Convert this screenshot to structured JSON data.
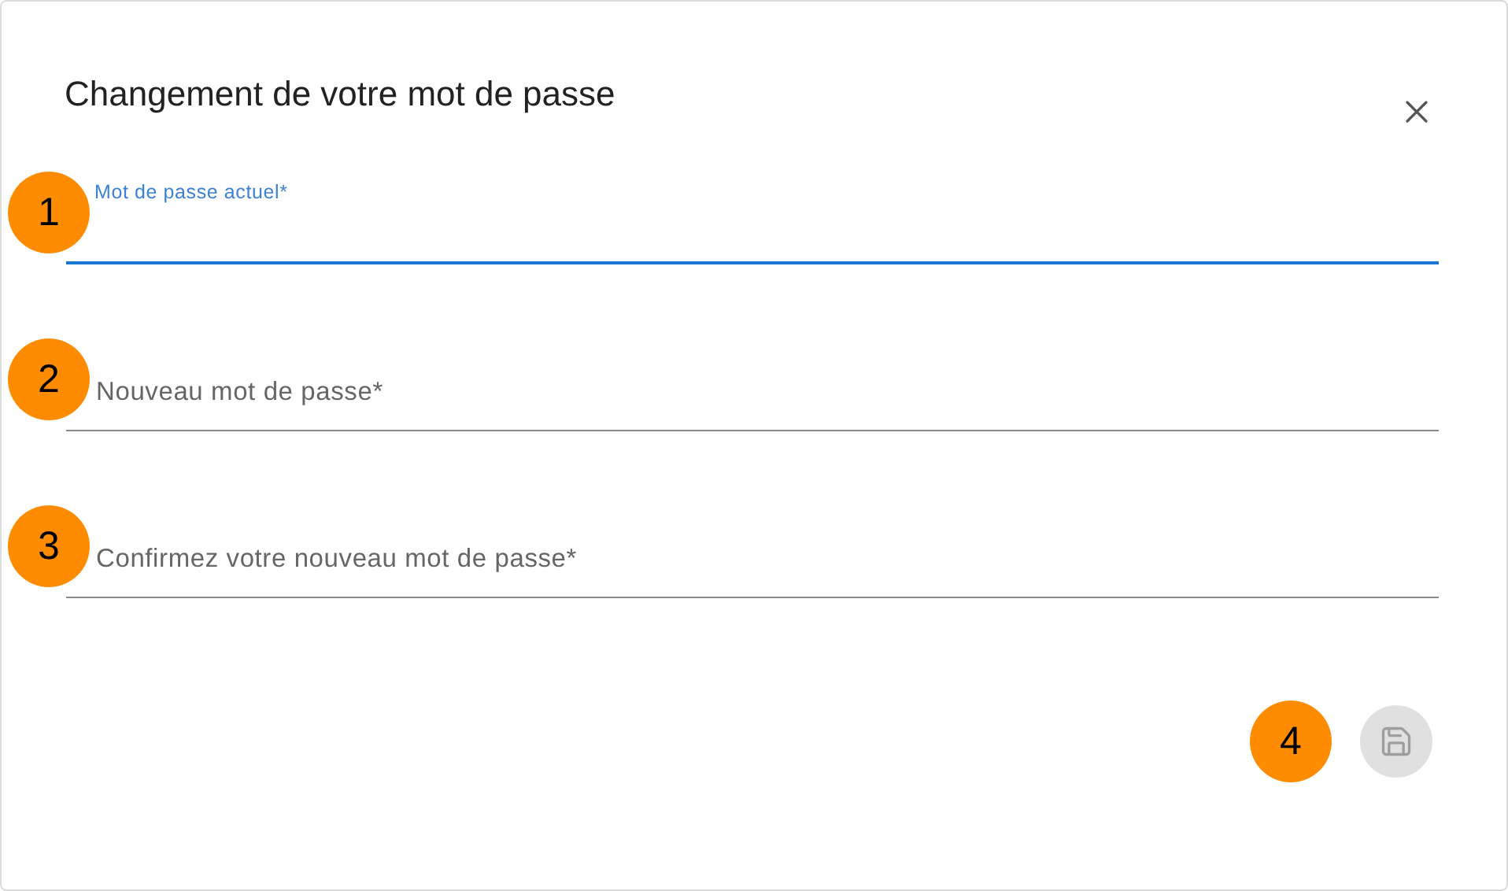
{
  "dialog": {
    "title": "Changement de votre mot de passe"
  },
  "fields": [
    {
      "label": "Mot de passe actuel*",
      "focused": true,
      "badge": "1"
    },
    {
      "label": "Nouveau mot de passe*",
      "focused": false,
      "badge": "2"
    },
    {
      "label": "Confirmez votre nouveau mot de passe*",
      "focused": false,
      "badge": "3"
    }
  ],
  "save_button": {
    "disabled": true,
    "badge": "4"
  }
}
